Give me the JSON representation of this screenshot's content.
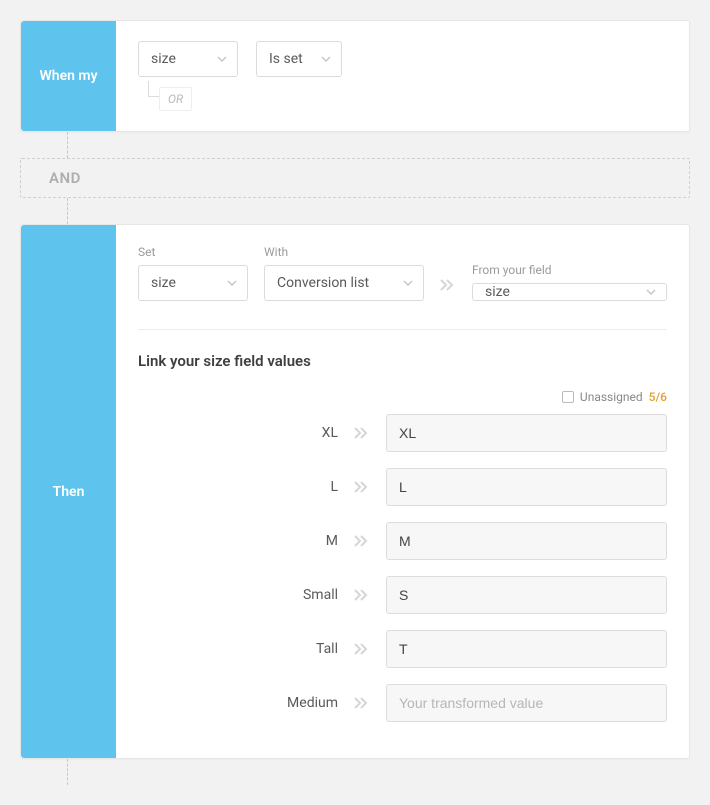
{
  "when": {
    "title": "When my",
    "field": "size",
    "operator": "Is set",
    "or_label": "OR"
  },
  "and_label": "AND",
  "then": {
    "title": "Then",
    "set_label": "Set",
    "set_value": "size",
    "with_label": "With",
    "with_value": "Conversion list",
    "from_label": "From your field",
    "from_value": "size"
  },
  "link": {
    "title": "Link your size field values",
    "unassigned_label": "Unassigned",
    "count": "5/6",
    "transformed_placeholder": "Your transformed value",
    "rows": [
      {
        "label": "XL",
        "value": "XL"
      },
      {
        "label": "L",
        "value": "L"
      },
      {
        "label": "M",
        "value": "M"
      },
      {
        "label": "Small",
        "value": "S"
      },
      {
        "label": "Tall",
        "value": "T"
      },
      {
        "label": "Medium",
        "value": ""
      }
    ]
  }
}
